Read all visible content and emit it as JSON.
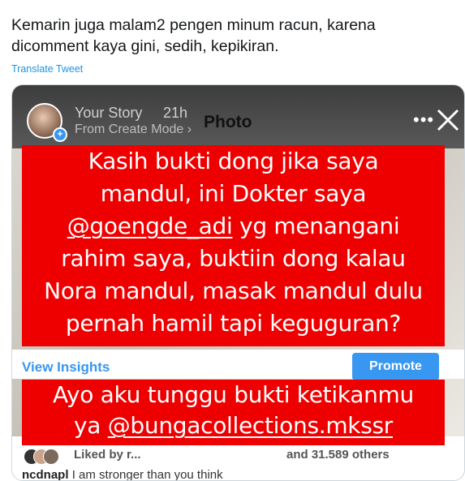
{
  "tweet": {
    "text": "Kemarin juga malam2 pengen minum racun, karena dicomment kaya gini, sedih, kepikiran.",
    "translate_label": "Translate Tweet"
  },
  "story": {
    "label": "Your Story",
    "time": "21h",
    "sub": "From Create Mode ›",
    "photo_title": "Photo",
    "menu_dots": "•••",
    "close_icon": "close-icon"
  },
  "red_box_1": {
    "line1": "Kasih bukti dong jika saya",
    "line2": "mandul, ini Dokter saya",
    "mention": "@goengde_adi",
    "line3_rest": " yg menangani",
    "line4": "rahim saya, buktiin dong kalau",
    "line5": "Nora mandul, masak mandul dulu",
    "line6": "pernah hamil tapi keguguran?"
  },
  "red_box_2": {
    "line1": "Ayo aku tunggu bukti ketikanmu",
    "line2_prefix": "ya ",
    "mention": "@bungacollections.mkssr"
  },
  "insights": {
    "view_label": "View Insights",
    "promote_label": "Promote"
  },
  "likes": {
    "liked_by": "Liked by r...",
    "others": "and 31.589 others"
  },
  "caption": {
    "user": "ncdnapl",
    "text": "I am stronger than you think"
  },
  "colors": {
    "red_box": "#ee0000",
    "instagram_blue": "#3897f0",
    "twitter_blue": "#1b95e0"
  }
}
